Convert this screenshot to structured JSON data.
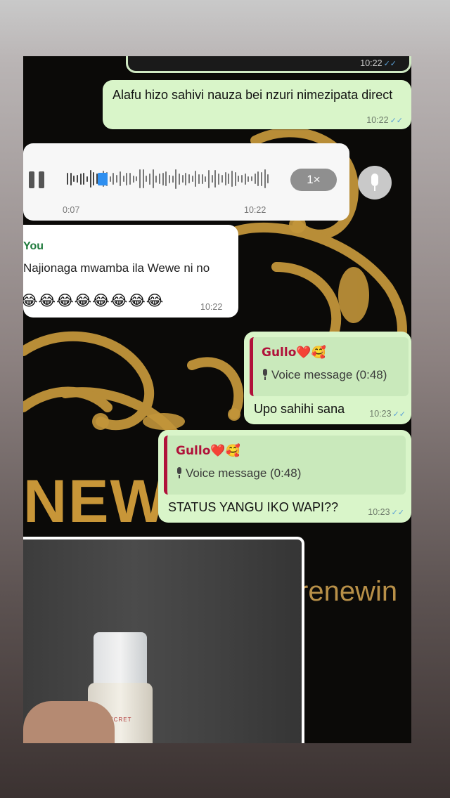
{
  "messages": {
    "m1": {
      "time": "10:22"
    },
    "m2": {
      "text": "Alafu hizo sahivi nauza bei nzuri nimezipata direct",
      "time": "10:22"
    },
    "voice": {
      "elapsed": "0:07",
      "time": "10:22",
      "speed": "1×",
      "progress": 0.15
    },
    "m3": {
      "sender": "You",
      "text": "Najionaga mwamba ila Wewe ni no",
      "emojis": "😂😂😂😂😂😂😂😂",
      "time": "10:22"
    },
    "m4": {
      "quote_name": "Gullo❤️🥰",
      "quote_voice": "Voice message (0:48)",
      "text": "Upo sahihi sana",
      "time": "10:23"
    },
    "m5": {
      "quote_name": "Gullo❤️🥰",
      "quote_voice": "Voice message (0:48)",
      "text": "STATUS YANGU IKO WAPI??",
      "time": "10:23"
    }
  },
  "wallpaper": {
    "word1": "NEW",
    "word2": "renewin"
  },
  "product": {
    "brand": "K-SECRET"
  },
  "colors": {
    "outgoing": "#d9f5c9",
    "incoming": "#ffffff",
    "quote_accent": "#b0123a",
    "ticks": "#5aa0d6",
    "gold": "#c89a3c"
  }
}
